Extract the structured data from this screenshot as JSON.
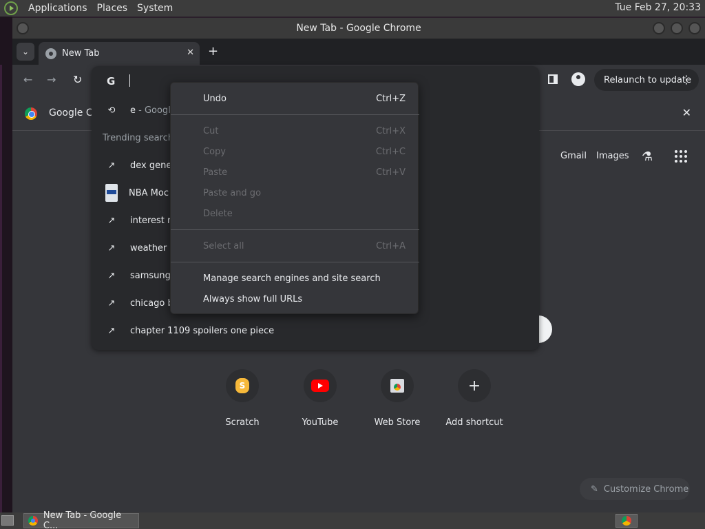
{
  "system_panel": {
    "menus": [
      "Applications",
      "Places",
      "System"
    ],
    "clock": "Tue Feb 27, 20:33"
  },
  "window": {
    "title": "New Tab - Google Chrome"
  },
  "tabs": {
    "active_title": "New Tab",
    "close_glyph": "✕",
    "new_tab_glyph": "+",
    "dropdown_glyph": "⌄"
  },
  "toolbar": {
    "back_glyph": "←",
    "forward_glyph": "→",
    "reload_glyph": "↻",
    "relaunch_label": "Relaunch to update",
    "menu_glyph": "⋮"
  },
  "infobar": {
    "text": "Google Ch",
    "close_glyph": "✕"
  },
  "ntp": {
    "gmail": "Gmail",
    "images": "Images",
    "shortcuts": [
      {
        "label": "Scratch"
      },
      {
        "label": "YouTube"
      },
      {
        "label": "Web Store"
      },
      {
        "label": "Add shortcut"
      }
    ],
    "customize_label": "Customize Chrome"
  },
  "omnibox": {
    "engine_glyph": "G",
    "history_item": {
      "text": "e",
      "suffix": " - Googl"
    },
    "trending_header": "Trending search",
    "trending": [
      "dex gener",
      "NBA Moc",
      "interest ra",
      "weather s",
      "samsung",
      "chicago b",
      "chapter 1109 spoilers one piece"
    ],
    "history_icon": "⟲",
    "trend_icon": "↗"
  },
  "context_menu": {
    "items": [
      {
        "label": "Undo",
        "shortcut": "Ctrl+Z",
        "enabled": true
      },
      {
        "label": "Cut",
        "shortcut": "Ctrl+X",
        "enabled": false
      },
      {
        "label": "Copy",
        "shortcut": "Ctrl+C",
        "enabled": false
      },
      {
        "label": "Paste",
        "shortcut": "Ctrl+V",
        "enabled": false
      },
      {
        "label": "Paste and go",
        "shortcut": "",
        "enabled": false
      },
      {
        "label": "Delete",
        "shortcut": "",
        "enabled": false
      },
      {
        "label": "Select all",
        "shortcut": "Ctrl+A",
        "enabled": false
      },
      {
        "label": "Manage search engines and site search",
        "shortcut": "",
        "enabled": true
      },
      {
        "label": "Always show full URLs",
        "shortcut": "",
        "enabled": true
      }
    ]
  },
  "taskbar": {
    "task_label": "New Tab - Google C..."
  }
}
